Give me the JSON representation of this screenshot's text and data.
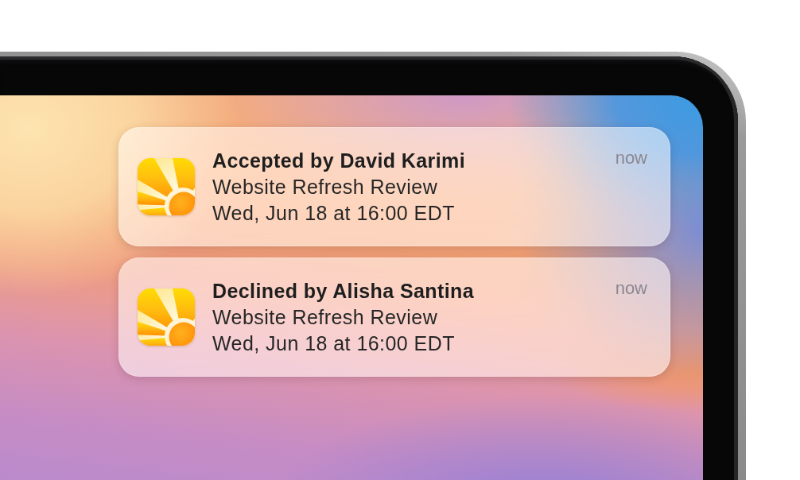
{
  "notifications": [
    {
      "title": "Accepted by David Karimi",
      "subtitle": "Website Refresh Review",
      "detail": "Wed, Jun 18 at 16:00 EDT",
      "time": "now"
    },
    {
      "title": "Declined by Alisha Santina",
      "subtitle": "Website Refresh Review",
      "detail": "Wed, Jun 18 at 16:00 EDT",
      "time": "now"
    }
  ]
}
